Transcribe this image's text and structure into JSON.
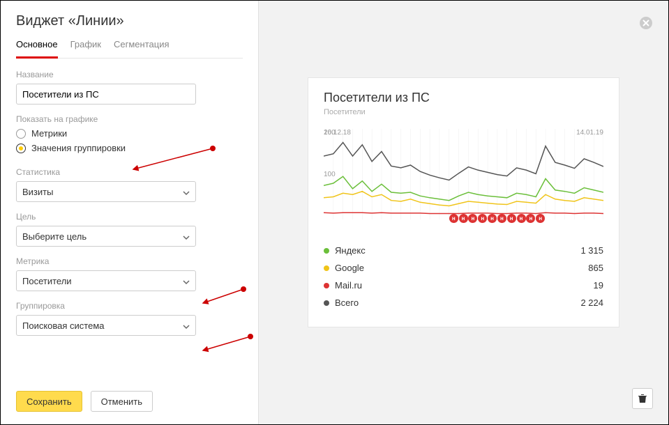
{
  "dialog": {
    "title": "Виджет «Линии»",
    "tabs": [
      "Основное",
      "График",
      "Сегментация"
    ],
    "active_tab": 0,
    "name_label": "Название",
    "name_value": "Посетители из ПС",
    "show_on_chart_label": "Показать на графике",
    "radio_metrics": "Метрики",
    "radio_group_values": "Значения группировки",
    "radio_selected": "group_values",
    "stat_label": "Статистика",
    "stat_value": "Визиты",
    "goal_label": "Цель",
    "goal_value": "Выберите цель",
    "metric_label": "Метрика",
    "metric_value": "Посетители",
    "grouping_label": "Группировка",
    "grouping_value": "Поисковая система",
    "save_label": "Сохранить",
    "cancel_label": "Отменить"
  },
  "preview": {
    "title": "Посетители из ПС",
    "subtitle": "Посетители",
    "x_start": "16.12.18",
    "x_end": "14.01.19",
    "y_ticks": [
      "200",
      "100"
    ],
    "legend": [
      {
        "name": "Яндекс",
        "value": "1 315",
        "color": "#6bbf3a"
      },
      {
        "name": "Google",
        "value": "865",
        "color": "#f0c419"
      },
      {
        "name": "Mail.ru",
        "value": "19",
        "color": "#d33"
      },
      {
        "name": "Всего",
        "value": "2 224",
        "color": "#555"
      }
    ]
  },
  "chart_data": {
    "type": "line",
    "xlabel": "",
    "ylabel": "",
    "ylim": [
      0,
      200
    ],
    "x_start": "16.12.18",
    "x_end": "14.01.19",
    "series": [
      {
        "name": "Яндекс",
        "color": "#6bbf3a",
        "values": [
          75,
          80,
          95,
          68,
          85,
          62,
          78,
          60,
          58,
          60,
          52,
          48,
          45,
          42,
          52,
          60,
          55,
          52,
          50,
          48,
          58,
          55,
          50,
          90,
          65,
          62,
          58,
          70,
          65,
          60
        ]
      },
      {
        "name": "Google",
        "color": "#f0c419",
        "values": [
          48,
          50,
          58,
          55,
          62,
          50,
          55,
          42,
          40,
          45,
          38,
          35,
          32,
          30,
          35,
          40,
          38,
          36,
          34,
          33,
          40,
          38,
          36,
          55,
          45,
          42,
          40,
          48,
          45,
          42
        ]
      },
      {
        "name": "Mail.ru",
        "color": "#d33",
        "values": [
          15,
          14,
          15,
          15,
          15,
          14,
          15,
          14,
          14,
          14,
          14,
          13,
          13,
          13,
          13,
          14,
          14,
          14,
          13,
          13,
          14,
          14,
          13,
          15,
          14,
          14,
          13,
          14,
          14,
          13
        ]
      },
      {
        "name": "Всего",
        "color": "#555",
        "values": [
          140,
          145,
          170,
          140,
          165,
          128,
          150,
          118,
          114,
          120,
          106,
          98,
          92,
          87,
          102,
          116,
          109,
          104,
          99,
          96,
          114,
          109,
          101,
          162,
          126,
          120,
          113,
          134,
          126,
          117
        ]
      }
    ]
  }
}
